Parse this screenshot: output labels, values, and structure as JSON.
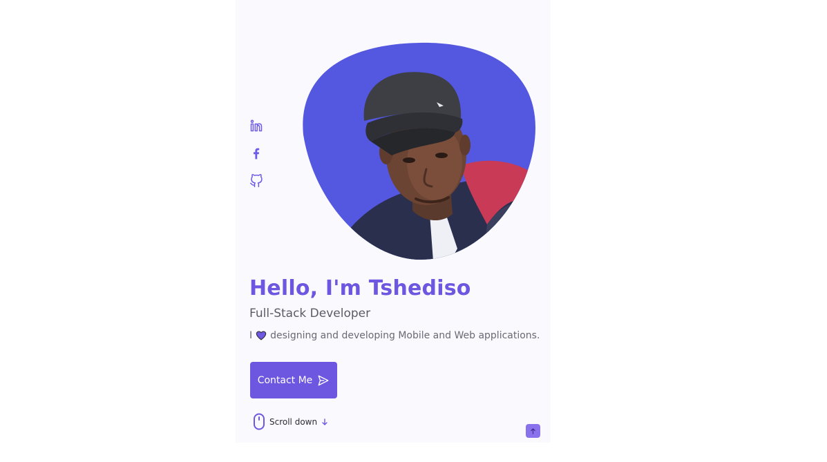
{
  "social": {
    "items": [
      {
        "name": "LinkedIn",
        "icon": "linkedin-icon"
      },
      {
        "name": "Facebook",
        "icon": "facebook-icon"
      },
      {
        "name": "GitHub",
        "icon": "github-icon"
      }
    ]
  },
  "home": {
    "title": "Hello, I'm Tshediso",
    "subtitle": "Full-Stack Developer",
    "description_prefix": "I",
    "description_icon": "heart-icon",
    "description_suffix": "designing and developing Mobile and Web applications.",
    "contact_button": {
      "label": "Contact Me",
      "icon": "send-icon"
    },
    "scroll_down": {
      "label": "Scroll down",
      "icon": "mouse-icon",
      "arrow_icon": "arrow-down-icon"
    }
  },
  "scroll_up": {
    "icon": "arrow-up-icon"
  },
  "colors": {
    "accent": "#6e57e0",
    "blob": "#5458e0",
    "background": "#faf9fd",
    "subtitle": "#5c5a66",
    "text": "#6b6875"
  }
}
